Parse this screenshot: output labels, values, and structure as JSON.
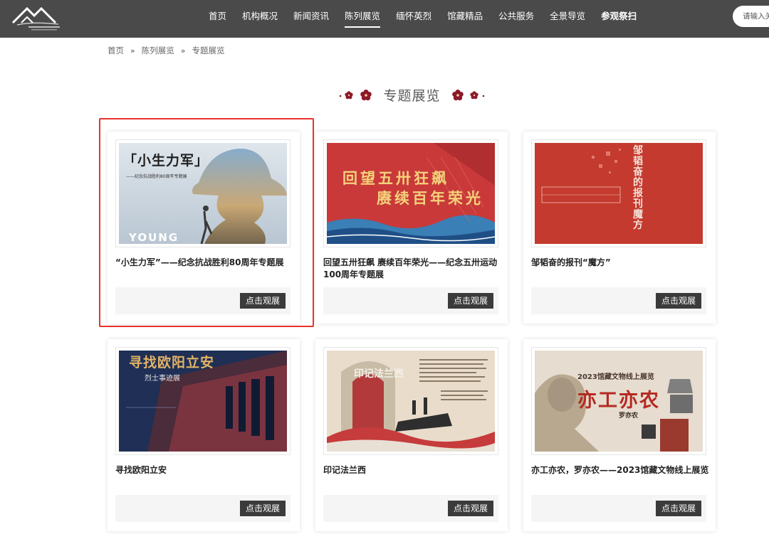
{
  "header": {
    "nav": [
      {
        "label": "首页"
      },
      {
        "label": "机构概况"
      },
      {
        "label": "新闻资讯"
      },
      {
        "label": "陈列展览",
        "active": true
      },
      {
        "label": "缅怀英烈"
      },
      {
        "label": "馆藏精品"
      },
      {
        "label": "公共服务"
      },
      {
        "label": "全景导览"
      },
      {
        "label": "参观祭扫",
        "bold": true
      }
    ],
    "search_placeholder": "请输入关键词"
  },
  "breadcrumb": {
    "items": [
      "首页",
      "陈列展览",
      "专题展览"
    ],
    "separator": "»"
  },
  "section": {
    "title": "专题展览",
    "accent_color": "#8b1a2b"
  },
  "cards": [
    {
      "title": "“小生力军”——纪念抗战胜利80周年专题展",
      "button": "点击观展",
      "image": {
        "headline": "「小生力军」",
        "subline": "——纪念抗战胜利80周年专题展",
        "footer": "YOUNG"
      }
    },
    {
      "title": "回望五卅狂飙 赓续百年荣光——纪念五卅运动100周年专题展",
      "button": "点击观展",
      "image": {
        "line1": "回望五卅狂飙",
        "line2": "赓续百年荣光"
      }
    },
    {
      "title": "邹韬奋的报刊“魔方”",
      "button": "点击观展",
      "image": {
        "headline": "邹韬奋的报刊魔方"
      }
    },
    {
      "title": "寻找欧阳立安",
      "button": "点击观展",
      "image": {
        "headline": "寻找欧阳立安",
        "subline": "烈士事迹展"
      }
    },
    {
      "title": "印记法兰西",
      "button": "点击观展",
      "image": {
        "headline": "印记法兰西"
      }
    },
    {
      "title": "亦工亦农，罗亦农——2023馆藏文物线上展览",
      "button": "点击观展",
      "image": {
        "headline": "亦工亦农",
        "subline": "2023馆藏文物线上展览",
        "name": "罗亦农"
      }
    }
  ],
  "colors": {
    "header_bg": "#4a4a4a",
    "button_bg": "#3b3b3b",
    "highlight": "#e8322c"
  }
}
